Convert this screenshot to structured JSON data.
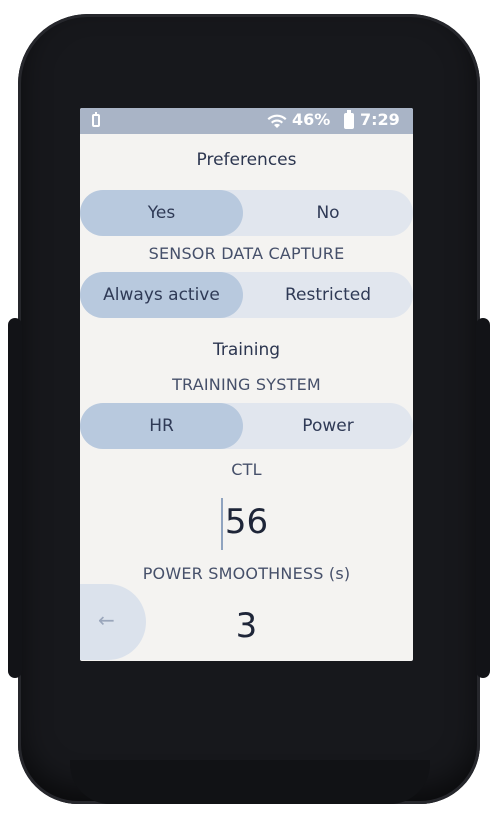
{
  "status": {
    "battery_percent": "46%",
    "time": "7:29",
    "icons": [
      "device-battery-icon",
      "wifi-icon",
      "battery-icon"
    ]
  },
  "preferences": {
    "title": "Preferences",
    "toggle": {
      "options": [
        "Yes",
        "No"
      ],
      "selected": "Yes"
    }
  },
  "sensor_data_capture": {
    "label": "SENSOR DATA CAPTURE",
    "options": [
      "Always active",
      "Restricted"
    ],
    "selected": "Always active"
  },
  "training": {
    "title": "Training",
    "system_label": "TRAINING SYSTEM",
    "options": [
      "HR",
      "Power"
    ],
    "selected": "HR",
    "ctl_label": "CTL",
    "ctl_value": "56",
    "power_smoothness_label": "POWER SMOOTHNESS (s)",
    "power_smoothness_value": "3"
  },
  "nav": {
    "back_symbol": "←"
  },
  "colors": {
    "statusbar": "#a9b4c6",
    "screen_bg": "#f4f3f1",
    "segment_bg": "#e1e6ee",
    "segment_selected": "#b8c9de",
    "text": "#2c3650",
    "bezel": "#17181c"
  }
}
